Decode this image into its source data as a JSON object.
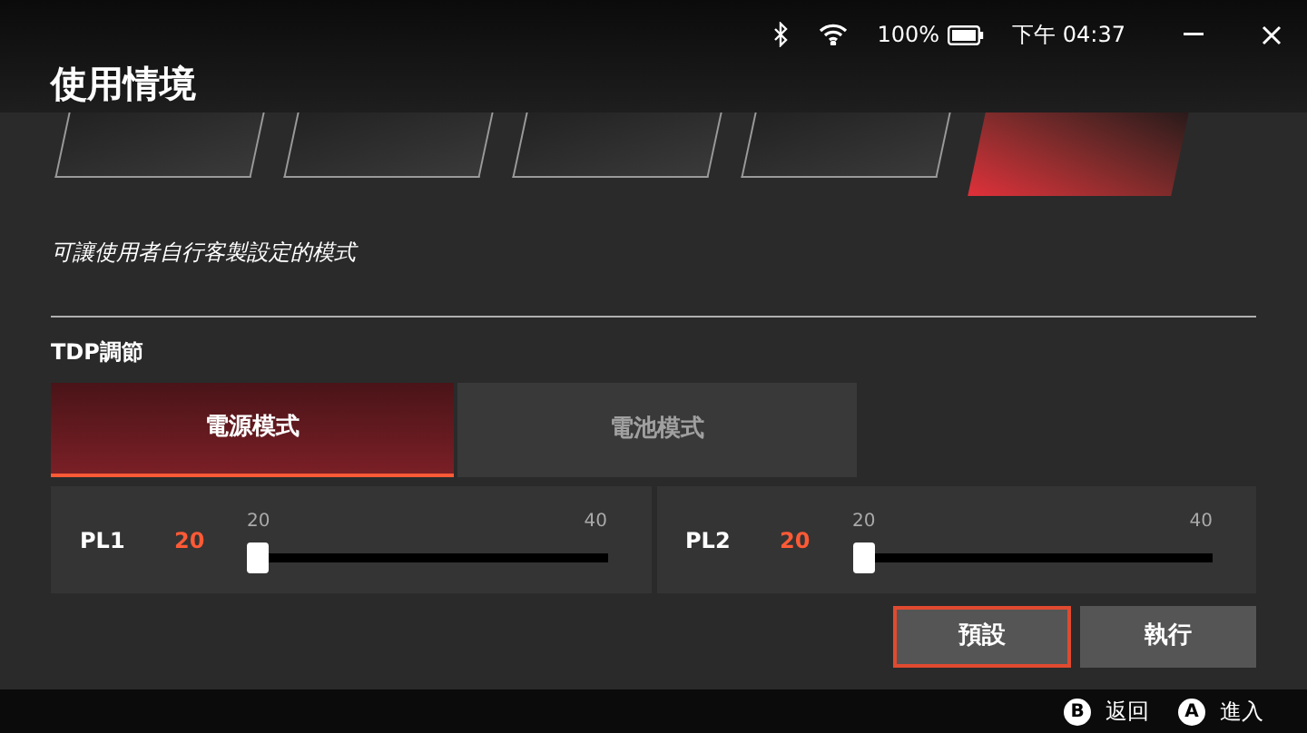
{
  "status_bar": {
    "battery": "100%",
    "time": "下午 04:37"
  },
  "title": "使用情境",
  "modes": [
    {
      "selected": false
    },
    {
      "selected": false
    },
    {
      "selected": false
    },
    {
      "selected": false
    },
    {
      "selected": true
    }
  ],
  "description": "可讓使用者自行客製設定的模式",
  "tdp": {
    "label": "TDP調節",
    "tabs": [
      {
        "label": "電源模式",
        "selected": true
      },
      {
        "label": "電池模式",
        "selected": false
      }
    ],
    "sliders": [
      {
        "name": "PL1",
        "value": "20",
        "min": "20",
        "max": "40",
        "level": 0
      },
      {
        "name": "PL2",
        "value": "20",
        "min": "20",
        "max": "40",
        "level": 0
      }
    ]
  },
  "buttons": [
    {
      "label": "預設",
      "selected": true
    },
    {
      "label": "執行",
      "selected": false
    }
  ],
  "footer": [
    {
      "key": "B",
      "label": "返回"
    },
    {
      "key": "A",
      "label": "進入"
    }
  ]
}
